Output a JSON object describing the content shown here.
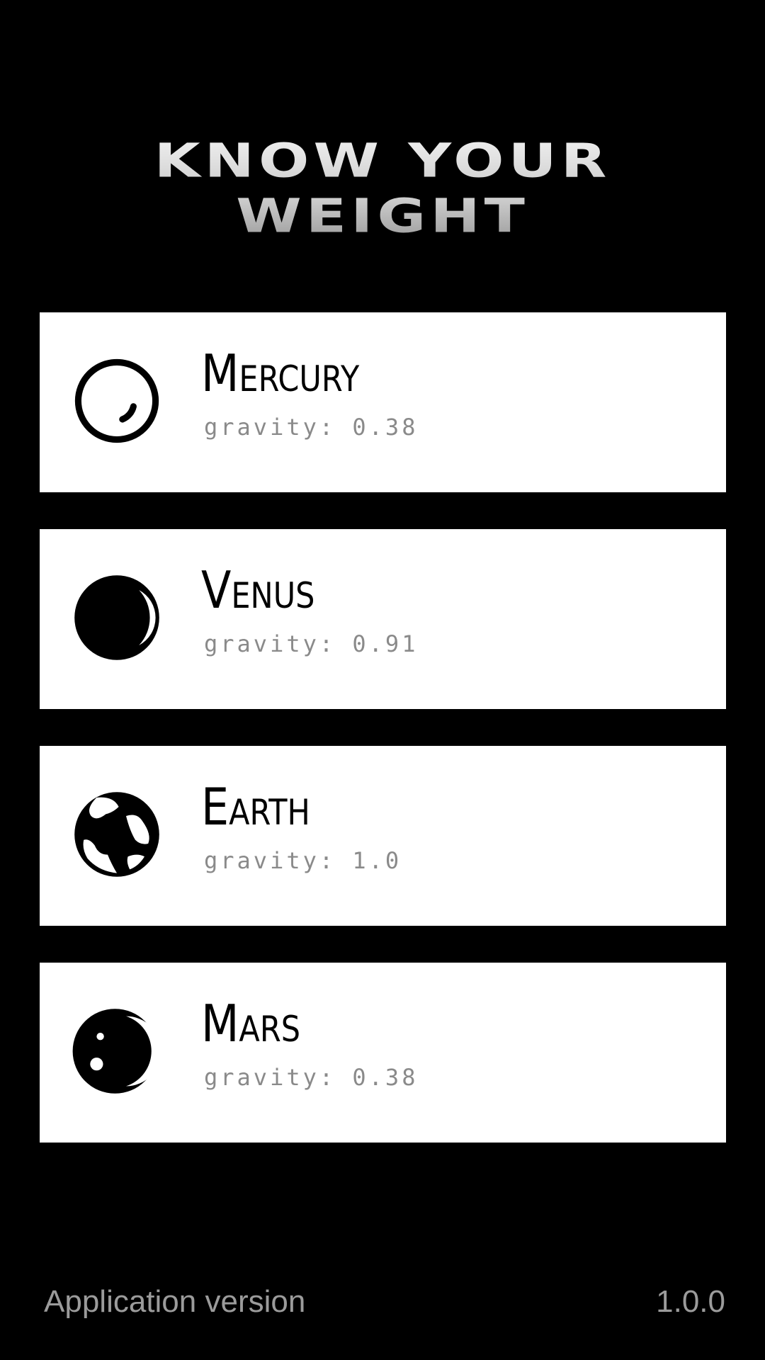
{
  "app": {
    "title": "Know your weight"
  },
  "planets": [
    {
      "name": "Mercury",
      "gravity_text": "gravity: 0.38",
      "icon": "mercury-icon"
    },
    {
      "name": "Venus",
      "gravity_text": "gravity: 0.91",
      "icon": "venus-icon"
    },
    {
      "name": "Earth",
      "gravity_text": "gravity: 1.0",
      "icon": "earth-icon"
    },
    {
      "name": "Mars",
      "gravity_text": "gravity: 0.38",
      "icon": "mars-icon"
    }
  ],
  "footer": {
    "label": "Application version",
    "version": "1.0.0"
  },
  "colors": {
    "background": "#000000",
    "card": "#ffffff",
    "text": "#000000",
    "secondary_text": "#8a8a8a",
    "footer_text": "#9b9b9b"
  }
}
